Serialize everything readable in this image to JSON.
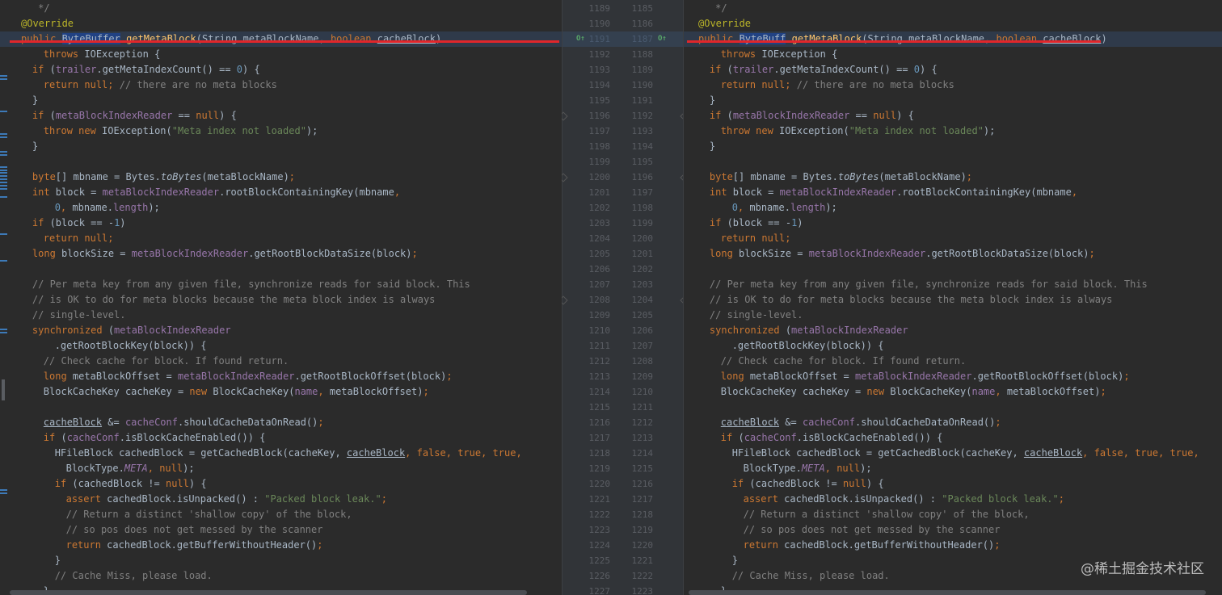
{
  "left_lines": [
    [
      [
        " */",
        "cmt"
      ]
    ],
    [
      [
        "@Override",
        "anno"
      ]
    ],
    [
      [
        "public ",
        "kw"
      ],
      [
        "ByteBuffer",
        "sel"
      ],
      [
        " ",
        "plain"
      ],
      [
        "getMetaBlock",
        "meth"
      ],
      [
        "(String metaBlockName, ",
        "plain"
      ],
      [
        "boolean ",
        "kw"
      ],
      [
        "cacheBlock",
        "ul"
      ],
      [
        ")",
        "plain"
      ]
    ],
    [
      [
        "throws ",
        "kw"
      ],
      [
        "IOException {",
        "plain"
      ]
    ],
    [
      [
        "if ",
        "kw"
      ],
      [
        "(",
        "plain"
      ],
      [
        "trailer",
        "field"
      ],
      [
        ".getMetaIndexCount() == ",
        "plain"
      ],
      [
        "0",
        "num"
      ],
      [
        ") {",
        "plain"
      ]
    ],
    [
      [
        "return null",
        "kw"
      ],
      [
        "; ",
        "kw"
      ],
      [
        "// there are no meta blocks",
        "cmt"
      ]
    ],
    [
      [
        "}",
        "plain"
      ]
    ],
    [
      [
        "if ",
        "kw"
      ],
      [
        "(",
        "plain"
      ],
      [
        "metaBlockIndexReader",
        "field"
      ],
      [
        " == ",
        "plain"
      ],
      [
        "null",
        "kw"
      ],
      [
        ") {",
        "plain"
      ]
    ],
    [
      [
        "throw new ",
        "kw"
      ],
      [
        "IOException(",
        "plain"
      ],
      [
        "\"Meta index not loaded\"",
        "str"
      ],
      [
        ");",
        "plain"
      ]
    ],
    [
      [
        "}",
        "plain"
      ]
    ],
    [
      [
        "",
        "plain"
      ]
    ],
    [
      [
        "byte",
        "kw"
      ],
      [
        "[] mbname = Bytes.",
        "plain"
      ],
      [
        "toBytes",
        "static"
      ],
      [
        "(metaBlockName)",
        "plain"
      ],
      [
        ";",
        "kw"
      ]
    ],
    [
      [
        "int ",
        "kw"
      ],
      [
        "block = ",
        "plain"
      ],
      [
        "metaBlockIndexReader",
        "field"
      ],
      [
        ".rootBlockContainingKey(mbname",
        "plain"
      ],
      [
        ",",
        "kw"
      ]
    ],
    [
      [
        "0",
        "num"
      ],
      [
        ", ",
        "kw"
      ],
      [
        "mbname.",
        "plain"
      ],
      [
        "length",
        "field"
      ],
      [
        ");",
        "plain"
      ]
    ],
    [
      [
        "if ",
        "kw"
      ],
      [
        "(block == -",
        "plain"
      ],
      [
        "1",
        "num"
      ],
      [
        ")",
        "plain"
      ]
    ],
    [
      [
        "return null",
        "kw"
      ],
      [
        ";",
        "kw"
      ]
    ],
    [
      [
        "long ",
        "kw"
      ],
      [
        "blockSize = ",
        "plain"
      ],
      [
        "metaBlockIndexReader",
        "field"
      ],
      [
        ".getRootBlockDataSize(block)",
        "plain"
      ],
      [
        ";",
        "kw"
      ]
    ],
    [
      [
        "",
        "plain"
      ]
    ],
    [
      [
        "// Per meta key from any given file, synchronize reads for said block. This",
        "cmt"
      ]
    ],
    [
      [
        "// is OK to do for meta blocks because the meta block index is always",
        "cmt"
      ]
    ],
    [
      [
        "// single-level.",
        "cmt"
      ]
    ],
    [
      [
        "synchronized ",
        "kw"
      ],
      [
        "(",
        "plain"
      ],
      [
        "metaBlockIndexReader",
        "field"
      ]
    ],
    [
      [
        ".getRootBlockKey(block)) {",
        "plain"
      ]
    ],
    [
      [
        "// Check cache for block. If found return.",
        "cmt"
      ]
    ],
    [
      [
        "long ",
        "kw"
      ],
      [
        "metaBlockOffset = ",
        "plain"
      ],
      [
        "metaBlockIndexReader",
        "field"
      ],
      [
        ".getRootBlockOffset(block)",
        "plain"
      ],
      [
        ";",
        "kw"
      ]
    ],
    [
      [
        "BlockCacheKey cacheKey = ",
        "plain"
      ],
      [
        "new ",
        "kw"
      ],
      [
        "BlockCacheKey(",
        "plain"
      ],
      [
        "name",
        "field"
      ],
      [
        ", ",
        "kw"
      ],
      [
        "metaBlockOffset)",
        "plain"
      ],
      [
        ";",
        "kw"
      ]
    ],
    [
      [
        "",
        "plain"
      ]
    ],
    [
      [
        "cacheBlock",
        "ul"
      ],
      [
        " &= ",
        "plain"
      ],
      [
        "cacheConf",
        "field"
      ],
      [
        ".shouldCacheDataOnRead()",
        "plain"
      ],
      [
        ";",
        "kw"
      ]
    ],
    [
      [
        "if ",
        "kw"
      ],
      [
        "(",
        "plain"
      ],
      [
        "cacheConf",
        "field"
      ],
      [
        ".isBlockCacheEnabled()) {",
        "plain"
      ]
    ],
    [
      [
        "HFileBlock cachedBlock = getCachedBlock(cacheKey, ",
        "plain"
      ],
      [
        "cacheBlock",
        "ul"
      ],
      [
        ", ",
        "kw"
      ],
      [
        "false, true, true,",
        "kw"
      ]
    ],
    [
      [
        "BlockType.",
        "plain"
      ],
      [
        "META",
        "fieldi"
      ],
      [
        ", ",
        "kw"
      ],
      [
        "null",
        "kw"
      ],
      [
        ");",
        "plain"
      ]
    ],
    [
      [
        "if ",
        "kw"
      ],
      [
        "(cachedBlock != ",
        "plain"
      ],
      [
        "null",
        "kw"
      ],
      [
        ") {",
        "plain"
      ]
    ],
    [
      [
        "assert ",
        "kw"
      ],
      [
        "cachedBlock.isUnpacked() : ",
        "plain"
      ],
      [
        "\"Packed block leak.\"",
        "str"
      ],
      [
        ";",
        "kw"
      ]
    ],
    [
      [
        "// Return a distinct 'shallow copy' of the block,",
        "cmt"
      ]
    ],
    [
      [
        "// so pos does not get messed by the scanner",
        "cmt"
      ]
    ],
    [
      [
        "return ",
        "kw"
      ],
      [
        "cachedBlock.getBufferWithoutHeader()",
        "plain"
      ],
      [
        ";",
        "kw"
      ]
    ],
    [
      [
        "}",
        "plain"
      ]
    ],
    [
      [
        "// Cache Miss, please load.",
        "cmt"
      ]
    ],
    [
      [
        "}",
        "plain"
      ]
    ]
  ],
  "right_lines": [
    [
      [
        " */",
        "cmt"
      ]
    ],
    [
      [
        "@Override",
        "anno"
      ]
    ],
    [
      [
        "public ",
        "kw"
      ],
      [
        "ByteBuff",
        "sel"
      ],
      [
        " ",
        "plain"
      ],
      [
        "getMetaBlock",
        "meth"
      ],
      [
        "(String metaBlockName, ",
        "plain"
      ],
      [
        "boolean ",
        "kw"
      ],
      [
        "cacheBlock",
        "ul"
      ],
      [
        ")",
        "plain"
      ]
    ],
    [
      [
        "throws ",
        "kw"
      ],
      [
        "IOException {",
        "plain"
      ]
    ],
    [
      [
        "if ",
        "kw"
      ],
      [
        "(",
        "plain"
      ],
      [
        "trailer",
        "field"
      ],
      [
        ".getMetaIndexCount() == ",
        "plain"
      ],
      [
        "0",
        "num"
      ],
      [
        ") {",
        "plain"
      ]
    ],
    [
      [
        "return null",
        "kw"
      ],
      [
        "; ",
        "kw"
      ],
      [
        "// there are no meta blocks",
        "cmt"
      ]
    ],
    [
      [
        "}",
        "plain"
      ]
    ],
    [
      [
        "if ",
        "kw"
      ],
      [
        "(",
        "plain"
      ],
      [
        "metaBlockIndexReader",
        "field"
      ],
      [
        " == ",
        "plain"
      ],
      [
        "null",
        "kw"
      ],
      [
        ") {",
        "plain"
      ]
    ],
    [
      [
        "throw new ",
        "kw"
      ],
      [
        "IOException(",
        "plain"
      ],
      [
        "\"Meta index not loaded\"",
        "str"
      ],
      [
        ");",
        "plain"
      ]
    ],
    [
      [
        "}",
        "plain"
      ]
    ],
    [
      [
        "",
        "plain"
      ]
    ],
    [
      [
        "byte",
        "kw"
      ],
      [
        "[] mbname = Bytes.",
        "plain"
      ],
      [
        "toBytes",
        "static"
      ],
      [
        "(metaBlockName)",
        "plain"
      ],
      [
        ";",
        "kw"
      ]
    ],
    [
      [
        "int ",
        "kw"
      ],
      [
        "block = ",
        "plain"
      ],
      [
        "metaBlockIndexReader",
        "field"
      ],
      [
        ".rootBlockContainingKey(mbname",
        "plain"
      ],
      [
        ",",
        "kw"
      ]
    ],
    [
      [
        "0",
        "num"
      ],
      [
        ", ",
        "kw"
      ],
      [
        "mbname.",
        "plain"
      ],
      [
        "length",
        "field"
      ],
      [
        ");",
        "plain"
      ]
    ],
    [
      [
        "if ",
        "kw"
      ],
      [
        "(block == -",
        "plain"
      ],
      [
        "1",
        "num"
      ],
      [
        ")",
        "plain"
      ]
    ],
    [
      [
        "return null",
        "kw"
      ],
      [
        ";",
        "kw"
      ]
    ],
    [
      [
        "long ",
        "kw"
      ],
      [
        "blockSize = ",
        "plain"
      ],
      [
        "metaBlockIndexReader",
        "field"
      ],
      [
        ".getRootBlockDataSize(block)",
        "plain"
      ],
      [
        ";",
        "kw"
      ]
    ],
    [
      [
        "",
        "plain"
      ]
    ],
    [
      [
        "// Per meta key from any given file, synchronize reads for said block. This",
        "cmt"
      ]
    ],
    [
      [
        "// is OK to do for meta blocks because the meta block index is always",
        "cmt"
      ]
    ],
    [
      [
        "// single-level.",
        "cmt"
      ]
    ],
    [
      [
        "synchronized ",
        "kw"
      ],
      [
        "(",
        "plain"
      ],
      [
        "metaBlockIndexReader",
        "field"
      ]
    ],
    [
      [
        ".getRootBlockKey(block)) {",
        "plain"
      ]
    ],
    [
      [
        "// Check cache for block. If found return.",
        "cmt"
      ]
    ],
    [
      [
        "long ",
        "kw"
      ],
      [
        "metaBlockOffset = ",
        "plain"
      ],
      [
        "metaBlockIndexReader",
        "field"
      ],
      [
        ".getRootBlockOffset(block)",
        "plain"
      ],
      [
        ";",
        "kw"
      ]
    ],
    [
      [
        "BlockCacheKey cacheKey = ",
        "plain"
      ],
      [
        "new ",
        "kw"
      ],
      [
        "BlockCacheKey(",
        "plain"
      ],
      [
        "name",
        "field"
      ],
      [
        ", ",
        "kw"
      ],
      [
        "metaBlockOffset)",
        "plain"
      ],
      [
        ";",
        "kw"
      ]
    ],
    [
      [
        "",
        "plain"
      ]
    ],
    [
      [
        "cacheBlock",
        "ul"
      ],
      [
        " &= ",
        "plain"
      ],
      [
        "cacheConf",
        "field"
      ],
      [
        ".shouldCacheDataOnRead()",
        "plain"
      ],
      [
        ";",
        "kw"
      ]
    ],
    [
      [
        "if ",
        "kw"
      ],
      [
        "(",
        "plain"
      ],
      [
        "cacheConf",
        "field"
      ],
      [
        ".isBlockCacheEnabled()) {",
        "plain"
      ]
    ],
    [
      [
        "HFileBlock cachedBlock = getCachedBlock(cacheKey, ",
        "plain"
      ],
      [
        "cacheBlock",
        "ul"
      ],
      [
        ", ",
        "kw"
      ],
      [
        "false, true, true,",
        "kw"
      ]
    ],
    [
      [
        "BlockType.",
        "plain"
      ],
      [
        "META",
        "fieldi"
      ],
      [
        ", ",
        "kw"
      ],
      [
        "null",
        "kw"
      ],
      [
        ");",
        "plain"
      ]
    ],
    [
      [
        "if ",
        "kw"
      ],
      [
        "(cachedBlock != ",
        "plain"
      ],
      [
        "null",
        "kw"
      ],
      [
        ") {",
        "plain"
      ]
    ],
    [
      [
        "assert ",
        "kw"
      ],
      [
        "cachedBlock.isUnpacked() : ",
        "plain"
      ],
      [
        "\"Packed block leak.\"",
        "str"
      ],
      [
        ";",
        "kw"
      ]
    ],
    [
      [
        "// Return a distinct 'shallow copy' of the block,",
        "cmt"
      ]
    ],
    [
      [
        "// so pos does not get messed by the scanner",
        "cmt"
      ]
    ],
    [
      [
        "return ",
        "kw"
      ],
      [
        "cachedBlock.getBufferWithoutHeader()",
        "plain"
      ],
      [
        ";",
        "kw"
      ]
    ],
    [
      [
        "}",
        "plain"
      ]
    ],
    [
      [
        "// Cache Miss, please load.",
        "cmt"
      ]
    ],
    [
      [
        "}",
        "plain"
      ]
    ]
  ],
  "left_line_numbers": [
    "1189",
    "1190",
    "1191",
    "1192",
    "1193",
    "1194",
    "1195",
    "1196",
    "1197",
    "1198",
    "1199",
    "1200",
    "1201",
    "1202",
    "1203",
    "1204",
    "1205",
    "1206",
    "1207",
    "1208",
    "1209",
    "1210",
    "1211",
    "1212",
    "1213",
    "1214",
    "1215",
    "1216",
    "1217",
    "1218",
    "1219",
    "1220",
    "1221",
    "1222",
    "1223",
    "1224",
    "1225",
    "1226",
    "1227"
  ],
  "right_line_numbers": [
    "1185",
    "1186",
    "1187",
    "1188",
    "1189",
    "1190",
    "1191",
    "1192",
    "1193",
    "1194",
    "1195",
    "1196",
    "1197",
    "1198",
    "1199",
    "1200",
    "1201",
    "1202",
    "1203",
    "1204",
    "1205",
    "1206",
    "1207",
    "1208",
    "1209",
    "1210",
    "1211",
    "1212",
    "1213",
    "1214",
    "1215",
    "1216",
    "1217",
    "1218",
    "1219",
    "1220",
    "1221",
    "1222",
    "1223"
  ],
  "gutter_icon_text": "O↑",
  "watermark": "@稀土掘金技术社区"
}
